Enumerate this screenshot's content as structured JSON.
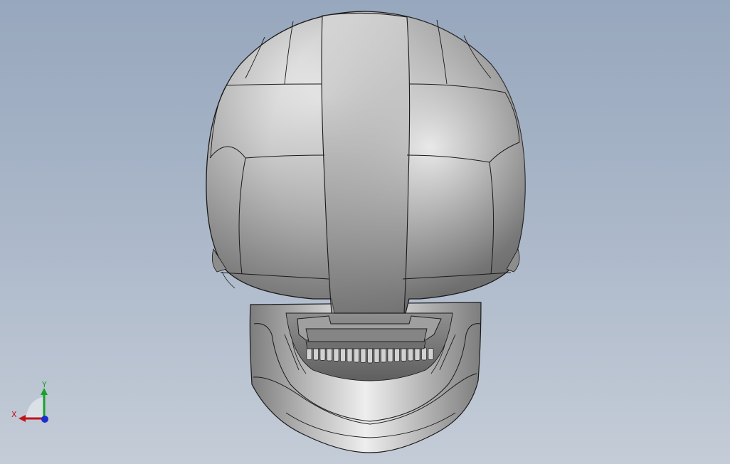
{
  "viewport": {
    "background_top": "#97a7bd",
    "background_bottom": "#c4ccd7"
  },
  "model": {
    "part": "skull",
    "shading_light": "#f4f4f4",
    "shading_dark": "#6f6f6f",
    "edge_color": "#1a1a1a"
  },
  "triad": {
    "x_label": "X",
    "y_label": "Y",
    "x_color": "#c0141b",
    "y_color": "#16a32a",
    "z_color": "#1b2fd0"
  }
}
